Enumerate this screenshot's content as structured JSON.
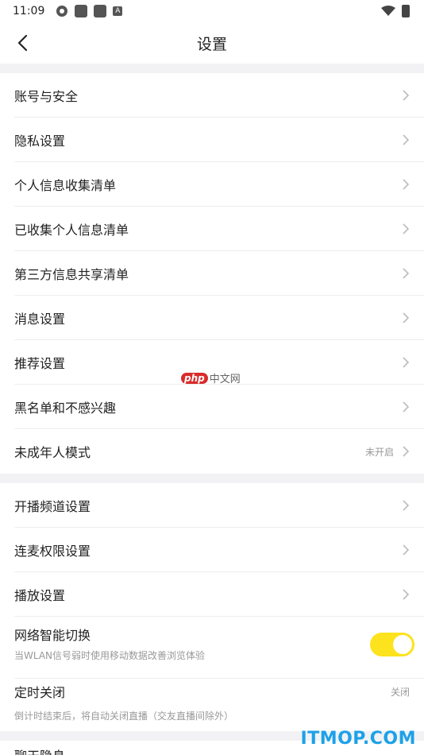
{
  "status": {
    "time": "11:09",
    "badge": "A"
  },
  "header": {
    "title": "设置"
  },
  "group1": [
    {
      "label": "账号与安全",
      "value": ""
    },
    {
      "label": "隐私设置",
      "value": ""
    },
    {
      "label": "个人信息收集清单",
      "value": ""
    },
    {
      "label": "已收集个人信息清单",
      "value": ""
    },
    {
      "label": "第三方信息共享清单",
      "value": ""
    },
    {
      "label": "消息设置",
      "value": ""
    },
    {
      "label": "推荐设置",
      "value": ""
    },
    {
      "label": "黑名单和不感兴趣",
      "value": ""
    },
    {
      "label": "未成年人模式",
      "value": "未开启"
    }
  ],
  "group2": [
    {
      "label": "开播频道设置"
    },
    {
      "label": "连麦权限设置"
    },
    {
      "label": "播放设置"
    }
  ],
  "network": {
    "label": "网络智能切换",
    "sub": "当WLAN信号弱时使用移动数据改善浏览体验",
    "on": true
  },
  "timer": {
    "label": "定时关闭",
    "sub": "倒计时结束后，将自动关闭直播（交友直播间除外）",
    "value": "关闭"
  },
  "partial": {
    "label": "聊天隐息"
  },
  "watermark": {
    "php": "php",
    "text": "中文网"
  },
  "footer_mark": "ITMOP.COM",
  "colors": {
    "toggle_on": "#fde21e",
    "band": "#f2f2f4",
    "footer": "#1da1e8"
  }
}
